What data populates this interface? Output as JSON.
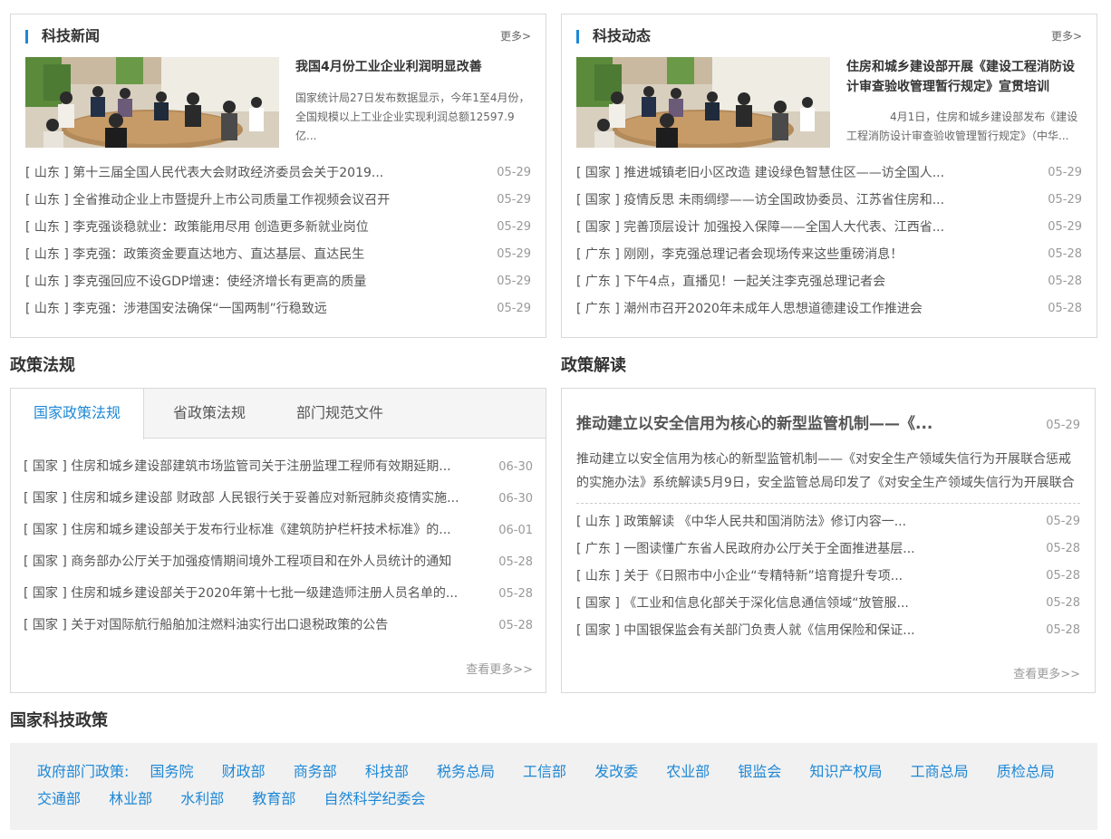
{
  "news": {
    "title": "科技新闻",
    "more": "更多>",
    "feature": {
      "title": "我国4月份工业企业利润明显改善",
      "desc": "国家统计局27日发布数据显示，今年1至4月份，全国规模以上工业企业实现利润总额12597.9亿..."
    },
    "items": [
      {
        "tag": "[ 山东 ]",
        "text": "第十三届全国人民代表大会财政经济委员会关于2019...",
        "date": "05-29"
      },
      {
        "tag": "[ 山东 ]",
        "text": "全省推动企业上市暨提升上市公司质量工作视频会议召开",
        "date": "05-29"
      },
      {
        "tag": "[ 山东 ]",
        "text": "李克强谈稳就业：政策能用尽用 创造更多新就业岗位",
        "date": "05-29"
      },
      {
        "tag": "[ 山东 ]",
        "text": "李克强：政策资金要直达地方、直达基层、直达民生",
        "date": "05-29"
      },
      {
        "tag": "[ 山东 ]",
        "text": "李克强回应不设GDP增速：使经济增长有更高的质量",
        "date": "05-29"
      },
      {
        "tag": "[ 山东 ]",
        "text": "李克强：涉港国安法确保“一国两制”行稳致远",
        "date": "05-29"
      }
    ]
  },
  "dynamics": {
    "title": "科技动态",
    "more": "更多>",
    "feature": {
      "title": "住房和城乡建设部开展《建设工程消防设计审查验收管理暂行规定》宣贯培训",
      "desc": "4月1日，住房和城乡建设部发布《建设工程消防设计审查验收管理暂行规定》（中华..."
    },
    "items": [
      {
        "tag": "[ 国家 ]",
        "text": "推进城镇老旧小区改造 建设绿色智慧住区——访全国人...",
        "date": "05-29"
      },
      {
        "tag": "[ 国家 ]",
        "text": "疫情反思 未雨绸缪——访全国政协委员、江苏省住房和...",
        "date": "05-29"
      },
      {
        "tag": "[ 国家 ]",
        "text": "完善顶层设计 加强投入保障——全国人大代表、江西省...",
        "date": "05-29"
      },
      {
        "tag": "[ 广东 ]",
        "text": "刚刚，李克强总理记者会现场传来这些重磅消息！",
        "date": "05-28"
      },
      {
        "tag": "[ 广东 ]",
        "text": "下午4点，直播见！一起关注李克强总理记者会",
        "date": "05-28"
      },
      {
        "tag": "[ 广东 ]",
        "text": "潮州市召开2020年未成年人思想道德建设工作推进会",
        "date": "05-28"
      }
    ]
  },
  "regulations": {
    "section_title": "政策法规",
    "tabs": [
      "国家政策法规",
      "省政策法规",
      "部门规范文件"
    ],
    "items": [
      {
        "tag": "[ 国家 ]",
        "text": "住房和城乡建设部建筑市场监管司关于注册监理工程师有效期延期...",
        "date": "06-30"
      },
      {
        "tag": "[ 国家 ]",
        "text": "住房和城乡建设部 财政部 人民银行关于妥善应对新冠肺炎疫情实施...",
        "date": "06-30"
      },
      {
        "tag": "[ 国家 ]",
        "text": "住房和城乡建设部关于发布行业标准《建筑防护栏杆技术标准》的...",
        "date": "06-01"
      },
      {
        "tag": "[ 国家 ]",
        "text": "商务部办公厅关于加强疫情期间境外工程项目和在外人员统计的通知",
        "date": "05-28"
      },
      {
        "tag": "[ 国家 ]",
        "text": "住房和城乡建设部关于2020年第十七批一级建造师注册人员名单的...",
        "date": "05-28"
      },
      {
        "tag": "[ 国家 ]",
        "text": "关于对国际航行船舶加注燃料油实行出口退税政策的公告",
        "date": "05-28"
      }
    ],
    "view_more": "查看更多>>"
  },
  "interpretation": {
    "section_title": "政策解读",
    "headline": {
      "title": "推动建立以安全信用为核心的新型监管机制——《...",
      "date": "05-29",
      "desc": "推动建立以安全信用为核心的新型监管机制——《对安全生产领域失信行为开展联合惩戒的实施办法》系统解读5月9日，安全监管总局印发了《对安全生产领域失信行为开展联合"
    },
    "items": [
      {
        "tag": "[ 山东 ]",
        "text": "政策解读 《中华人民共和国消防法》修订内容一...",
        "date": "05-29"
      },
      {
        "tag": "[ 广东 ]",
        "text": "一图读懂广东省人民政府办公厅关于全面推进基层...",
        "date": "05-28"
      },
      {
        "tag": "[ 山东 ]",
        "text": "关于《日照市中小企业“专精特新”培育提升专项...",
        "date": "05-28"
      },
      {
        "tag": "[ 国家 ]",
        "text": "《工业和信息化部关于深化信息通信领域“放管服...",
        "date": "05-28"
      },
      {
        "tag": "[ 国家 ]",
        "text": "中国银保监会有关部门负责人就《信用保险和保证...",
        "date": "05-28"
      }
    ],
    "view_more": "查看更多>>"
  },
  "national_policy": {
    "section_title": "国家科技政策",
    "label": "政府部门政策:",
    "links": [
      "国务院",
      "财政部",
      "商务部",
      "科技部",
      "税务总局",
      "工信部",
      "发改委",
      "农业部",
      "银监会",
      "知识产权局",
      "工商总局",
      "质检总局",
      "交通部",
      "林业部",
      "水利部",
      "教育部",
      "自然科学纪委会"
    ]
  },
  "colors": {
    "accent": "#1e88d6",
    "border": "#d9d9d9",
    "bar_bg": "#f1f1f1"
  }
}
